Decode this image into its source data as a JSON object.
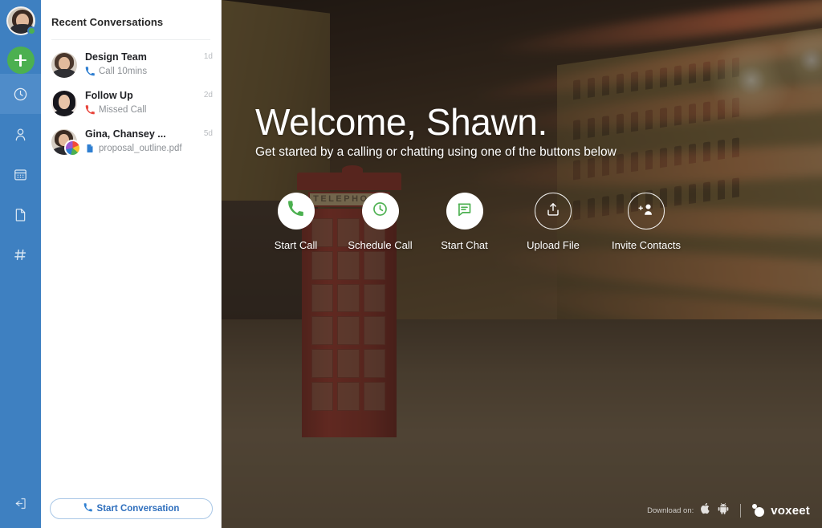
{
  "rail": {
    "avatar_name": "user-avatar",
    "status": "online",
    "add_label": "+",
    "items": [
      {
        "name": "recent-calls",
        "icon": "clock-icon",
        "active": true
      },
      {
        "name": "contacts",
        "icon": "person-icon",
        "active": false
      },
      {
        "name": "calendar",
        "icon": "calendar-icon",
        "active": false
      },
      {
        "name": "files",
        "icon": "document-icon",
        "active": false
      },
      {
        "name": "channels",
        "icon": "hash-icon",
        "active": false
      }
    ],
    "logout": {
      "name": "logout",
      "icon": "logout-icon"
    }
  },
  "panel": {
    "title": "Recent Conversations",
    "conversations": [
      {
        "name": "Design Team",
        "subtitle": "Call 10mins",
        "subtitle_icon": "phone-icon",
        "subtitle_color": "#2f7fd1",
        "time": "1d",
        "group": false
      },
      {
        "name": "Follow Up",
        "subtitle": "Missed Call",
        "subtitle_icon": "phone-icon",
        "subtitle_color": "#e8453c",
        "time": "2d",
        "group": false
      },
      {
        "name": "Gina, Chansey ...",
        "subtitle": "proposal_outline.pdf",
        "subtitle_icon": "file-icon",
        "subtitle_color": "#2f7fd1",
        "time": "5d",
        "group": true
      }
    ],
    "start_conversation_label": "Start Conversation",
    "start_conversation_icon": "phone-icon"
  },
  "hero": {
    "title": "Welcome, Shawn.",
    "subtitle": "Get started by a calling or chatting using one of the buttons below",
    "background_sign_text": "TELEPHONE",
    "actions": [
      {
        "label": "Start Call",
        "icon": "phone-icon",
        "style": "solid"
      },
      {
        "label": "Schedule Call",
        "icon": "clock-icon",
        "style": "solid"
      },
      {
        "label": "Start Chat",
        "icon": "chat-bubble-icon",
        "style": "solid"
      },
      {
        "label": "Upload File",
        "icon": "upload-icon",
        "style": "outline"
      },
      {
        "label": "Invite Contacts",
        "icon": "add-person-icon",
        "style": "outline"
      }
    ],
    "download": {
      "label": "Download on:",
      "platforms": [
        "apple-icon",
        "android-icon"
      ]
    },
    "brand": {
      "name": "voxeet"
    }
  },
  "colors": {
    "rail_bg": "#3e80c1",
    "rail_active": "#4f8cc9",
    "accent_green": "#4cb050",
    "accent_blue": "#2f7fd1",
    "danger_red": "#e8453c"
  }
}
